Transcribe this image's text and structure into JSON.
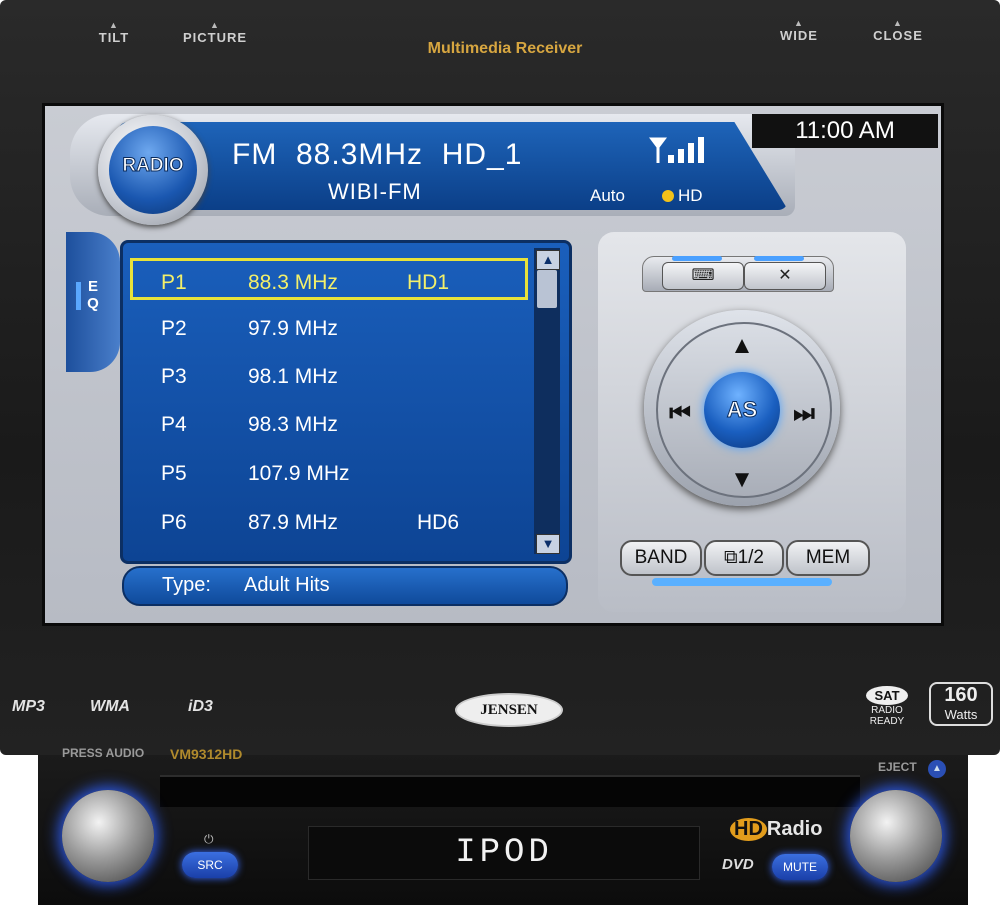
{
  "device": {
    "title": "Multimedia Receiver",
    "top_buttons": [
      "TILT",
      "PICTURE",
      "WIDE",
      "CLOSE"
    ],
    "brand": "JENSEN",
    "model": "VM9312HD",
    "formats": [
      "MP3",
      "WMA",
      "iD3"
    ],
    "sat_label": "SAT",
    "sat_sub": "RADIO READY",
    "watts_value": "160",
    "watts_label": "Watts",
    "press_audio": "PRESS AUDIO",
    "eject": "EJECT",
    "front_display": "IPOD",
    "src_button": "SRC",
    "mute_button": "MUTE",
    "hd_radio": "Radio",
    "hd_mark": "HD",
    "dvd": "DVD"
  },
  "screen": {
    "mode_label": "RADIO",
    "band": "FM",
    "frequency": "88.3MHz",
    "hd_channel": "HD_1",
    "station": "WIBI-FM",
    "tuning_mode": "Auto",
    "hd_indicator": "HD",
    "clock": "11:00  AM",
    "eq_label": "E Q",
    "presets": [
      {
        "id": "P1",
        "freq": "88.3 MHz",
        "hd": "HD1",
        "selected": true
      },
      {
        "id": "P2",
        "freq": "97.9  MHz",
        "hd": "",
        "selected": false
      },
      {
        "id": "P3",
        "freq": "98.1  MHz",
        "hd": "",
        "selected": false
      },
      {
        "id": "P4",
        "freq": "98.3 MHz",
        "hd": "",
        "selected": false
      },
      {
        "id": "P5",
        "freq": "107.9 MHz",
        "hd": "",
        "selected": false
      },
      {
        "id": "P6",
        "freq": "87.9 MHz",
        "hd": "HD6",
        "selected": false
      }
    ],
    "type_label": "Type:",
    "type_value": "Adult Hits",
    "as_button": "AS",
    "band_button": "BAND",
    "page_button": "1/2",
    "mem_button": "MEM"
  },
  "colors": {
    "screen_blue": "#1a5fbc",
    "selection": "#e8e23a",
    "title_gold": "#d7a640",
    "glow_blue": "#4aa0ff"
  },
  "icons": [
    "signal-strength-icon",
    "keyboard-icon",
    "settings-tools-icon",
    "up-arrow-icon",
    "down-arrow-icon",
    "previous-track-icon",
    "next-track-icon",
    "power-icon",
    "eject-icon"
  ]
}
